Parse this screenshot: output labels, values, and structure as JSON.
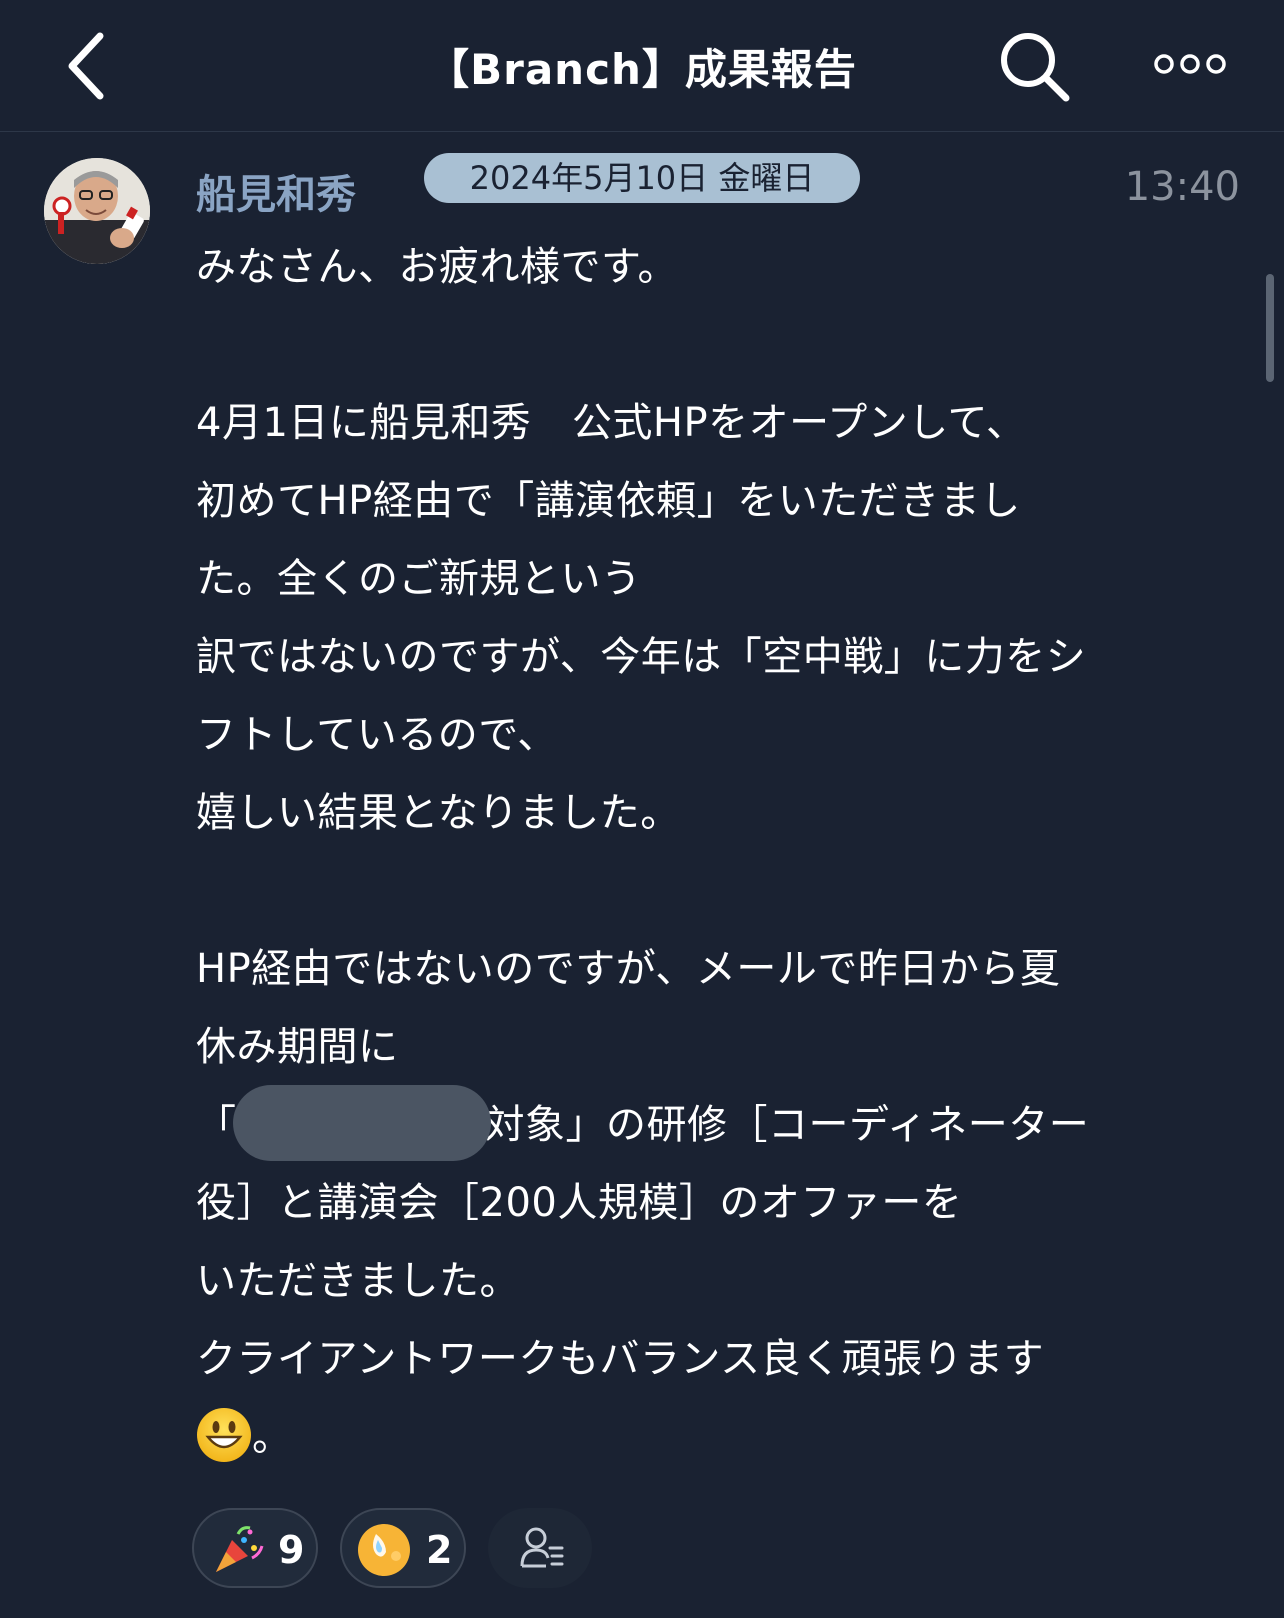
{
  "header": {
    "title": "【Branch】成果報告",
    "back_icon": "chevron-left-icon",
    "search_icon": "search-icon",
    "more_icon": "more-dots-icon"
  },
  "message": {
    "sender": "船見和秀",
    "date": "2024年5月10日 金曜日",
    "time": "13:40",
    "lines": [
      "みなさん、お疲れ様です。",
      "",
      "4月1日に船見和秀　公式HPをオープンして、",
      "初めてHP経由で「講演依頼」をいただきまし",
      "た。全くのご新規という",
      "訳ではないのですが、今年は「空中戦」に力をシ",
      "フトしているので、",
      "嬉しい結果となりました。",
      "",
      "HP経由ではないのですが、メールで昨日から夏",
      "休み期間に"
    ],
    "redacted_line_prefix": "「",
    "redacted_line_suffix": "対象」の研修［コーディネーター",
    "lines_after": [
      "役］と講演会［200人規模］のオファーを",
      "いただきました。",
      "クライアントワークもバランス良く頑張ります"
    ],
    "final_suffix": "。",
    "final_emoji": "grinning-face-emoji"
  },
  "reactions": [
    {
      "icon": "party-popper-icon",
      "count": "9"
    },
    {
      "icon": "smiling-sweat-face-icon",
      "count": "2"
    }
  ],
  "colors": {
    "background": "#1a2232",
    "sender": "#8aa4c4",
    "date_pill": "#a9c0d3",
    "time": "#8c939e",
    "text": "#ffffff"
  }
}
